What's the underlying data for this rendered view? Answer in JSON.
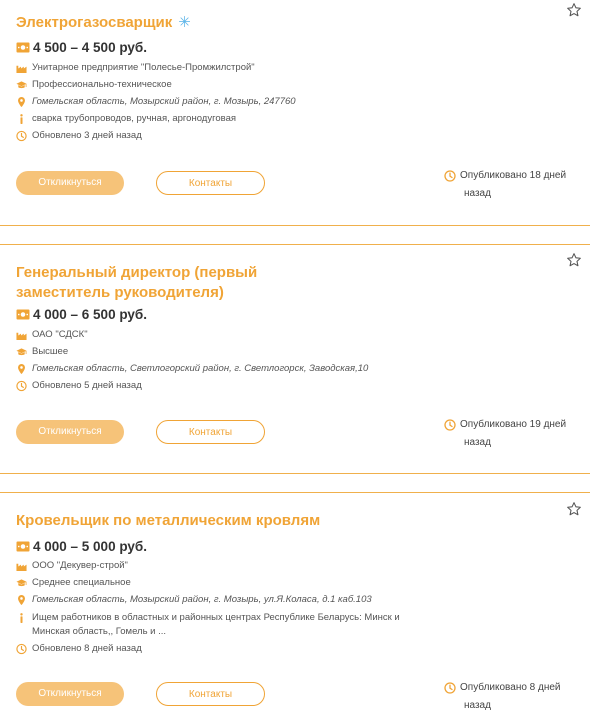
{
  "colors": {
    "accent": "#f0a436",
    "button_fill": "#f6c379",
    "divider": "#f0b04c"
  },
  "vacancies": [
    {
      "title": "Электрогазосварщик",
      "has_badge": true,
      "salary": "4 500 – 4 500 руб.",
      "company": "Унитарное предприятие \"Полесье-Промжилстрой\"",
      "education": "Профессионально-техническое",
      "address": "Гомельская область, Мозырский район, г. Мозырь, 247760",
      "info": "сварка трубопроводов, ручная, аргонодуговая",
      "updated": "Обновлено 3 дней назад",
      "apply_label": "Откликнуться",
      "contacts_label": "Контакты",
      "published_line1": "Опубликовано 18 дней",
      "published_line2": "назад"
    },
    {
      "title": "Генеральный директор (первый заместитель руководителя)",
      "salary": "4 000 – 6 500 руб.",
      "company": "ОАО \"СДСК\"",
      "education": "Высшее",
      "address": "Гомельская область, Светлогорский район, г. Светлогорск, Заводская,10",
      "updated": "Обновлено 5 дней назад",
      "apply_label": "Откликнуться",
      "contacts_label": "Контакты",
      "published_line1": "Опубликовано 19 дней",
      "published_line2": "назад"
    },
    {
      "title": "Кровельщик по металлическим кровлям",
      "salary": "4 000 – 5 000 руб.",
      "company": "ООО \"Декувер-строй\"",
      "education": "Среднее специальное",
      "address": "Гомельская область, Мозырский район, г. Мозырь, ул.Я.Коласа, д.1 каб.103",
      "info": "Ищем работников в областных и районных центрах Республике Беларусь: Минск и Минская область,, Гомель и ...",
      "updated": "Обновлено 8 дней назад",
      "apply_label": "Откликнуться",
      "contacts_label": "Контакты",
      "published_line1": "Опубликовано 8 дней",
      "published_line2": "назад"
    }
  ]
}
